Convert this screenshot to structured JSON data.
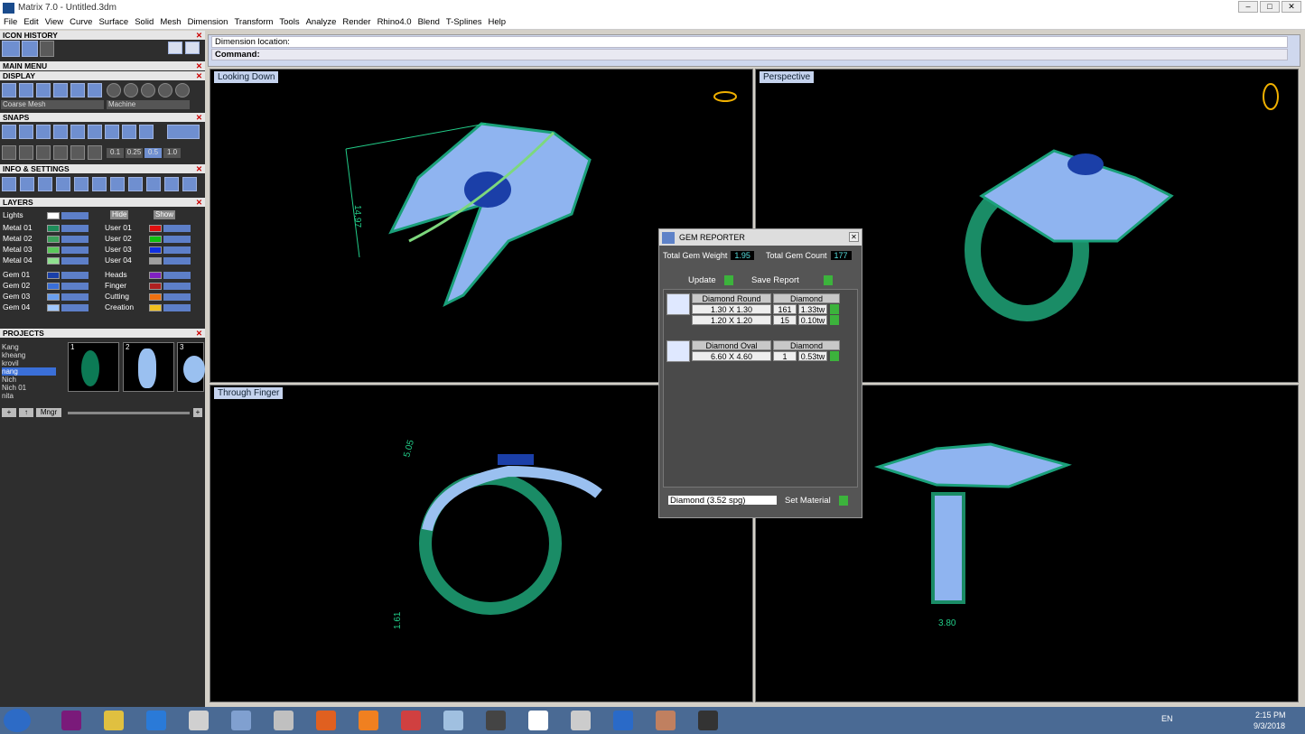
{
  "app": {
    "title": "Matrix 7.0 - Untitled.3dm"
  },
  "menu": [
    "File",
    "Edit",
    "View",
    "Curve",
    "Surface",
    "Solid",
    "Mesh",
    "Dimension",
    "Transform",
    "Tools",
    "Analyze",
    "Render",
    "Rhino4.0",
    "Blend",
    "T-Splines",
    "Help"
  ],
  "panels": {
    "icon_history": "ICON HISTORY",
    "main_menu": "MAIN MENU",
    "display": "DISPLAY",
    "snaps": "SNAPS",
    "info": "INFO & SETTINGS",
    "layers": "LAYERS",
    "projects": "PROJECTS"
  },
  "display": {
    "mesh": "Coarse Mesh",
    "render": "Machine"
  },
  "snaps": {
    "values": [
      "0.1",
      "0.25",
      "0.5",
      "1.0"
    ]
  },
  "layers": {
    "lights": "Lights",
    "hide": "Hide",
    "show": "Show",
    "left": [
      {
        "name": "Metal 01",
        "color": "#1e8c5a"
      },
      {
        "name": "Metal 02",
        "color": "#3ca05a"
      },
      {
        "name": "Metal 03",
        "color": "#5ac85a"
      },
      {
        "name": "Metal 04",
        "color": "#8fe08f"
      },
      {
        "name": "Gem 01",
        "color": "#1a3fa8"
      },
      {
        "name": "Gem 02",
        "color": "#3a6fd8"
      },
      {
        "name": "Gem 03",
        "color": "#6a9fef"
      },
      {
        "name": "Gem 04",
        "color": "#a0c8ff"
      }
    ],
    "right": [
      {
        "name": "User 01",
        "color": "#e01010"
      },
      {
        "name": "User 02",
        "color": "#10c010"
      },
      {
        "name": "User 03",
        "color": "#1030e0"
      },
      {
        "name": "User 04",
        "color": "#a0a0a0"
      },
      {
        "name": "Heads",
        "color": "#8020c0"
      },
      {
        "name": "Finger",
        "color": "#b02020"
      },
      {
        "name": "Cutting",
        "color": "#f07010"
      },
      {
        "name": "Creation",
        "color": "#f0c020"
      }
    ]
  },
  "projects": {
    "items": [
      "Kang",
      "kheang",
      "krovil",
      "nang",
      "Nich",
      "Nich 01",
      "nita"
    ],
    "selected": "nang",
    "thumbs": [
      "1",
      "2",
      "3"
    ],
    "mngr": "Mngr"
  },
  "command": {
    "prompt": "Dimension location:",
    "label": "Command:"
  },
  "viewports": {
    "top_left": "Looking Down",
    "top_right": "Perspective",
    "bottom_left": "Through Finger"
  },
  "dims": {
    "d1": "14.97",
    "d2": "5.05",
    "d3": "1.61",
    "d4": "3.80"
  },
  "gem_reporter": {
    "title": "GEM REPORTER",
    "weight_label": "Total Gem Weight",
    "weight": "1.95",
    "count_label": "Total Gem Count",
    "count": "177",
    "update": "Update",
    "save": "Save Report",
    "groups": [
      {
        "shape": "Diamond Round",
        "material": "Diamond",
        "rows": [
          {
            "size": "1.30 X 1.30",
            "qty": "161",
            "tw": "1.33tw"
          },
          {
            "size": "1.20 X 1.20",
            "qty": "15",
            "tw": "0.10tw"
          }
        ]
      },
      {
        "shape": "Diamond Oval",
        "material": "Diamond",
        "rows": [
          {
            "size": "6.60 X 4.60",
            "qty": "1",
            "tw": "0.53tw"
          }
        ]
      }
    ],
    "material_select": "Diamond    (3.52 spg)",
    "set_material": "Set Material"
  },
  "taskbar": {
    "lang": "EN",
    "time": "2:15 PM",
    "date": "9/3/2018"
  }
}
